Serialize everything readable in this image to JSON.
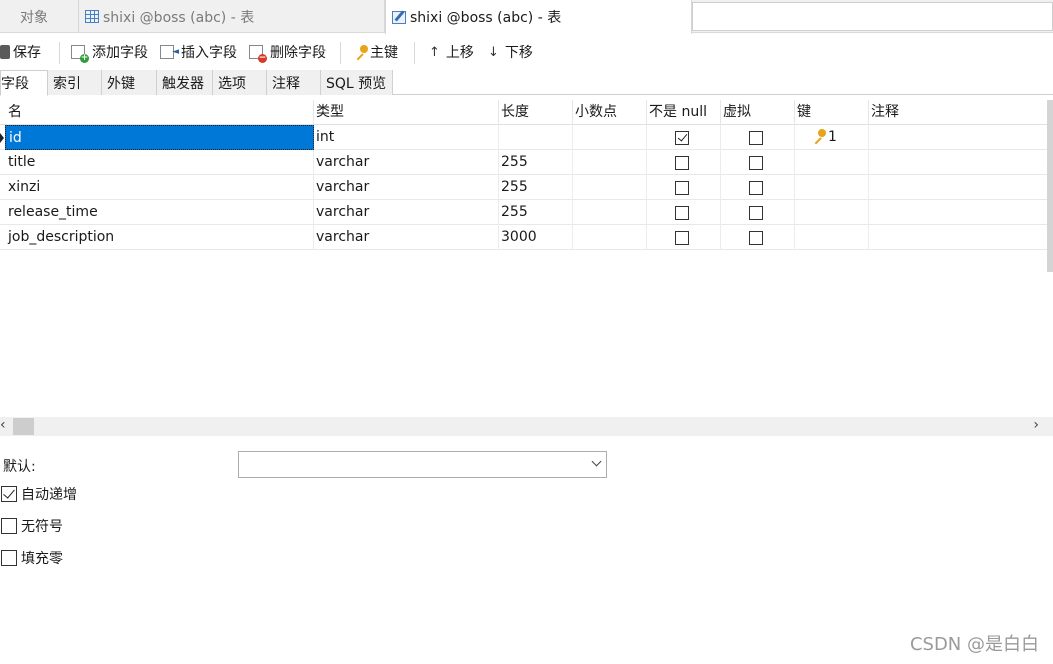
{
  "tabs": [
    {
      "label": "对象",
      "icon": "none"
    },
    {
      "label": "shixi @boss (abc) - 表",
      "icon": "table-grid-icon"
    },
    {
      "label": "shixi @boss (abc) - 表",
      "icon": "table-edit-icon",
      "active": true
    }
  ],
  "toolbar": {
    "save": "保存",
    "add_field": "添加字段",
    "insert_field": "插入字段",
    "delete_field": "删除字段",
    "primary_key": "主键",
    "move_up": "上移",
    "move_down": "下移"
  },
  "subtabs": [
    "字段",
    "索引",
    "外键",
    "触发器",
    "选项",
    "注释",
    "SQL 预览"
  ],
  "grid": {
    "columns": [
      "名",
      "类型",
      "长度",
      "小数点",
      "不是 null",
      "虚拟",
      "键",
      "注释"
    ],
    "rows": [
      {
        "name": "id",
        "type": "int",
        "length": "",
        "decimals": "",
        "not_null": true,
        "virtual": false,
        "key": "1",
        "comment": ""
      },
      {
        "name": "title",
        "type": "varchar",
        "length": "255",
        "decimals": "",
        "not_null": false,
        "virtual": false,
        "key": "",
        "comment": ""
      },
      {
        "name": "xinzi",
        "type": "varchar",
        "length": "255",
        "decimals": "",
        "not_null": false,
        "virtual": false,
        "key": "",
        "comment": ""
      },
      {
        "name": "release_time",
        "type": "varchar",
        "length": "255",
        "decimals": "",
        "not_null": false,
        "virtual": false,
        "key": "",
        "comment": ""
      },
      {
        "name": "job_description",
        "type": "varchar",
        "length": "3000",
        "decimals": "",
        "not_null": false,
        "virtual": false,
        "key": "",
        "comment": ""
      }
    ]
  },
  "form": {
    "default_label": "默认:",
    "default_value": "",
    "auto_increment": {
      "label": "自动递增",
      "checked": true
    },
    "unsigned": {
      "label": "无符号",
      "checked": false
    },
    "zerofill": {
      "label": "填充零",
      "checked": false
    }
  },
  "watermark": "CSDN @是白白"
}
